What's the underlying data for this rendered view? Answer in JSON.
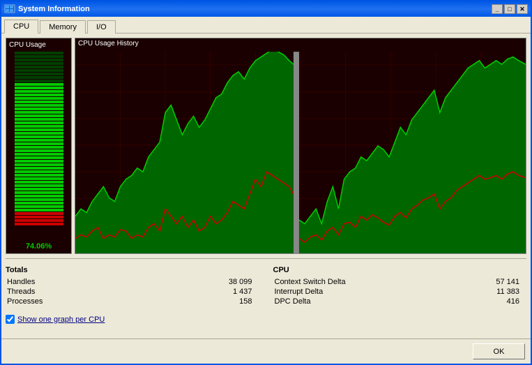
{
  "window": {
    "title": "System Information",
    "icon": "computer-icon"
  },
  "titleButtons": {
    "minimize": "_",
    "maximize": "□",
    "close": "✕"
  },
  "tabs": [
    {
      "label": "CPU",
      "active": true
    },
    {
      "label": "Memory",
      "active": false
    },
    {
      "label": "I/O",
      "active": false
    }
  ],
  "cpuUsage": {
    "label": "CPU Usage",
    "percent": "74.06%",
    "value": 74
  },
  "cpuHistory": {
    "label": "CPU Usage History"
  },
  "totals": {
    "title": "Totals",
    "rows": [
      {
        "name": "Handles",
        "value": "38 099"
      },
      {
        "name": "Threads",
        "value": "1 437"
      },
      {
        "name": "Processes",
        "value": "158"
      }
    ]
  },
  "cpu": {
    "title": "CPU",
    "rows": [
      {
        "name": "Context Switch Delta",
        "value": "57 141"
      },
      {
        "name": "Interrupt Delta",
        "value": "11 383"
      },
      {
        "name": "DPC Delta",
        "value": "416"
      }
    ]
  },
  "checkbox": {
    "checked": true,
    "label": "Show one graph per CPU"
  },
  "okButton": "OK"
}
